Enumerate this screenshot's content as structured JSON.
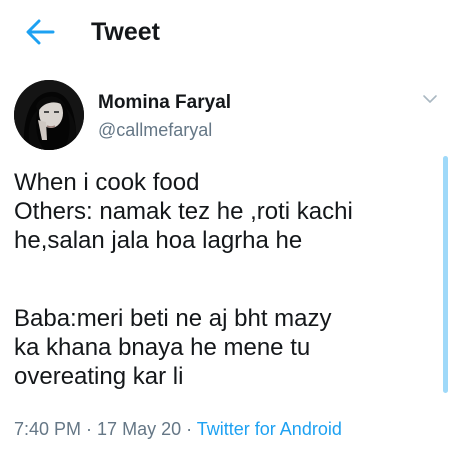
{
  "header": {
    "back_icon": "arrow-left-icon",
    "title": "Tweet"
  },
  "colors": {
    "accent": "#1da1f2",
    "text": "#14171a",
    "secondary": "#657786",
    "scrollbar": "#9fd9f9"
  },
  "tweet": {
    "author": {
      "name": "Momina Faryal",
      "handle": "@callmefaryal",
      "avatar_icon": "profile-photo"
    },
    "more_icon": "chevron-down-icon",
    "text_lines": [
      "When i cook food",
      "Others: namak tez he ,roti kachi",
      "he,salan jala hoa lagrha he",
      "",
      "Baba:meri beti ne aj bht mazy",
      "ka khana bnaya he mene tu",
      "overeating kar li"
    ],
    "meta": {
      "time": "7:40 PM",
      "separator": " · ",
      "date": "17 May 20",
      "source": "Twitter for Android"
    }
  }
}
